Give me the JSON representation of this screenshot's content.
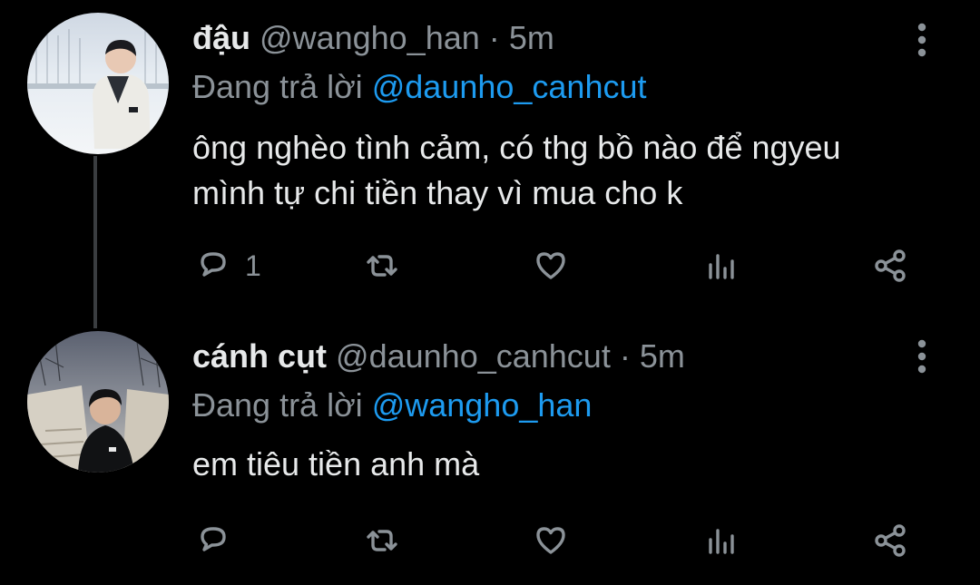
{
  "colors": {
    "background": "#000000",
    "text_primary": "#e7e9ea",
    "text_secondary": "#8b9298",
    "accent": "#1d9bf0",
    "thread_line": "#3a3d40"
  },
  "tweets": [
    {
      "display_name": "đậu",
      "handle": "@wangho_han",
      "separator": "·",
      "time": "5m",
      "reply_prefix": "Đang trả lời",
      "reply_to": "@daunho_canhcut",
      "body_lines": [
        "ông nghèo tình cảm, có thg bồ nào để ngyeu",
        "mình tự chi tiền thay vì mua cho k"
      ],
      "reply_count": "1",
      "icons": [
        "reply-icon",
        "retweet-icon",
        "like-icon",
        "views-icon",
        "share-icon",
        "more-icon"
      ]
    },
    {
      "display_name": "cánh cụt",
      "handle": "@daunho_canhcut",
      "separator": "·",
      "time": "5m",
      "reply_prefix": "Đang trả lời",
      "reply_to": "@wangho_han",
      "body_lines": [
        "em tiêu tiền anh mà"
      ],
      "reply_count": "",
      "icons": [
        "reply-icon",
        "retweet-icon",
        "like-icon",
        "views-icon",
        "share-icon",
        "more-icon"
      ]
    }
  ]
}
